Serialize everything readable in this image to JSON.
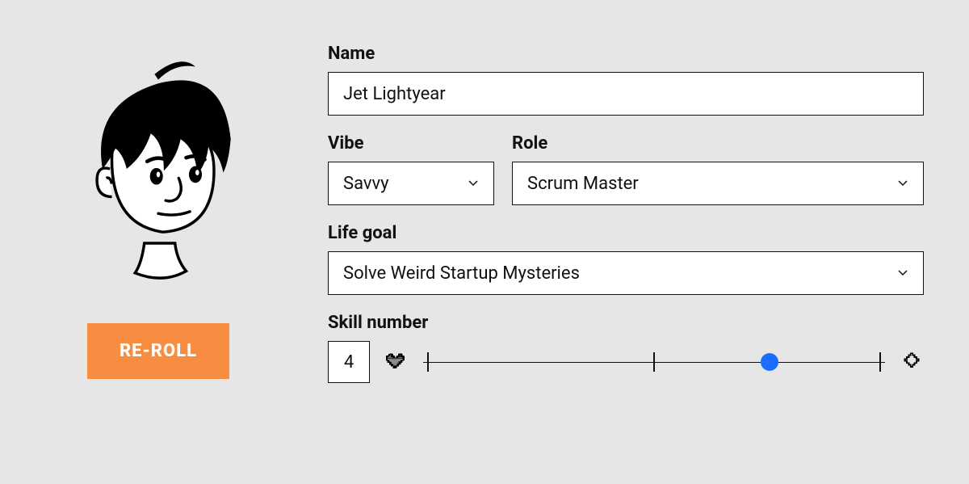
{
  "reroll": {
    "label": "RE-ROLL"
  },
  "fields": {
    "name": {
      "label": "Name",
      "value": "Jet Lightyear"
    },
    "vibe": {
      "label": "Vibe",
      "value": "Savvy"
    },
    "role": {
      "label": "Role",
      "value": "Scrum Master"
    },
    "goal": {
      "label": "Life goal",
      "value": "Solve Weird Startup Mysteries"
    },
    "skill": {
      "label": "Skill number",
      "value": "4"
    }
  },
  "slider": {
    "min": 1,
    "max": 5,
    "value": 4,
    "ticks": [
      1,
      3,
      5
    ]
  },
  "icons": {
    "heart": "heart-icon",
    "diamond": "diamond-icon",
    "chevron": "chevron-down-icon"
  },
  "colors": {
    "accent_orange": "#f78d41",
    "slider_blue": "#1a6dff",
    "bg": "#e6e6e6",
    "border": "#111111"
  }
}
